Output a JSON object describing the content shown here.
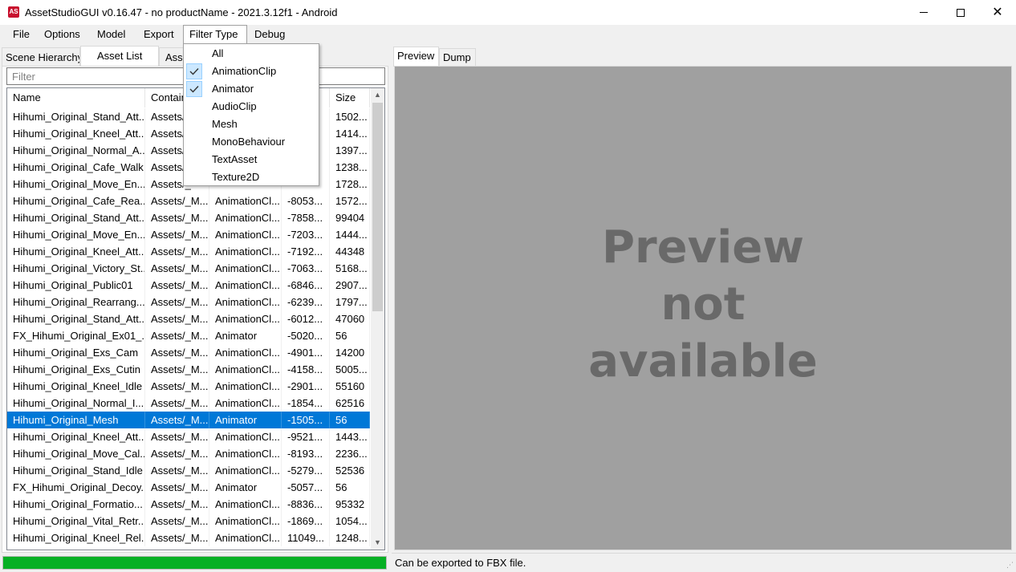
{
  "window": {
    "title": "AssetStudioGUI v0.16.47 - no productName - 2021.3.12f1 - Android",
    "icon_label": "AS",
    "icon_color": "#c8102e"
  },
  "menu": {
    "file": "File",
    "options": "Options",
    "model": "Model",
    "export": "Export",
    "filter_type": "Filter Type",
    "debug": "Debug"
  },
  "filter_dropdown": {
    "items": [
      {
        "label": "All",
        "checked": false
      },
      {
        "label": "AnimationClip",
        "checked": true
      },
      {
        "label": "Animator",
        "checked": true
      },
      {
        "label": "AudioClip",
        "checked": false
      },
      {
        "label": "Mesh",
        "checked": false
      },
      {
        "label": "MonoBehaviour",
        "checked": false
      },
      {
        "label": "TextAsset",
        "checked": false
      },
      {
        "label": "Texture2D",
        "checked": false
      }
    ]
  },
  "left_tabs": {
    "scene_hierarchy": "Scene Hierarchy",
    "asset_list": "Asset List",
    "asset_classes": "Asse"
  },
  "filter_box": {
    "placeholder": "Filter",
    "value": ""
  },
  "asset_list": {
    "columns": [
      "Name",
      "Contain",
      "",
      "",
      "Size"
    ],
    "rows": [
      [
        "Hihumi_Original_Stand_Att...",
        "Assets/_",
        "",
        "",
        "1502..."
      ],
      [
        "Hihumi_Original_Kneel_Att...",
        "Assets/_",
        "",
        "",
        "1414..."
      ],
      [
        "Hihumi_Original_Normal_A...",
        "Assets/_",
        "",
        "",
        "1397..."
      ],
      [
        "Hihumi_Original_Cafe_Walk",
        "Assets/_",
        "",
        "",
        "1238..."
      ],
      [
        "Hihumi_Original_Move_En...",
        "Assets/_",
        "",
        "",
        "1728..."
      ],
      [
        "Hihumi_Original_Cafe_Rea...",
        "Assets/_M...",
        "AnimationCl...",
        "-8053...",
        "1572..."
      ],
      [
        "Hihumi_Original_Stand_Att...",
        "Assets/_M...",
        "AnimationCl...",
        "-7858...",
        "99404"
      ],
      [
        "Hihumi_Original_Move_En...",
        "Assets/_M...",
        "AnimationCl...",
        "-7203...",
        "1444..."
      ],
      [
        "Hihumi_Original_Kneel_Att...",
        "Assets/_M...",
        "AnimationCl...",
        "-7192...",
        "44348"
      ],
      [
        "Hihumi_Original_Victory_St...",
        "Assets/_M...",
        "AnimationCl...",
        "-7063...",
        "5168..."
      ],
      [
        "Hihumi_Original_Public01",
        "Assets/_M...",
        "AnimationCl...",
        "-6846...",
        "2907..."
      ],
      [
        "Hihumi_Original_Rearrang...",
        "Assets/_M...",
        "AnimationCl...",
        "-6239...",
        "1797..."
      ],
      [
        "Hihumi_Original_Stand_Att...",
        "Assets/_M...",
        "AnimationCl...",
        "-6012...",
        "47060"
      ],
      [
        "FX_Hihumi_Original_Ex01_...",
        "Assets/_M...",
        "Animator",
        "-5020...",
        "56"
      ],
      [
        "Hihumi_Original_Exs_Cam",
        "Assets/_M...",
        "AnimationCl...",
        "-4901...",
        "14200"
      ],
      [
        "Hihumi_Original_Exs_Cutin",
        "Assets/_M...",
        "AnimationCl...",
        "-4158...",
        "5005..."
      ],
      [
        "Hihumi_Original_Kneel_Idle",
        "Assets/_M...",
        "AnimationCl...",
        "-2901...",
        "55160"
      ],
      [
        "Hihumi_Original_Normal_I...",
        "Assets/_M...",
        "AnimationCl...",
        "-1854...",
        "62516"
      ],
      [
        "Hihumi_Original_Mesh",
        "Assets/_M...",
        "Animator",
        "-1505...",
        "56"
      ],
      [
        "Hihumi_Original_Kneel_Att...",
        "Assets/_M...",
        "AnimationCl...",
        "-9521...",
        "1443..."
      ],
      [
        "Hihumi_Original_Move_Cal...",
        "Assets/_M...",
        "AnimationCl...",
        "-8193...",
        "2236..."
      ],
      [
        "Hihumi_Original_Stand_Idle",
        "Assets/_M...",
        "AnimationCl...",
        "-5279...",
        "52536"
      ],
      [
        "FX_Hihumi_Original_Decoy...",
        "Assets/_M...",
        "Animator",
        "-5057...",
        "56"
      ],
      [
        "Hihumi_Original_Formatio...",
        "Assets/_M...",
        "AnimationCl...",
        "-8836...",
        "95332"
      ],
      [
        "Hihumi_Original_Vital_Retr...",
        "Assets/_M...",
        "AnimationCl...",
        "-1869...",
        "1054..."
      ],
      [
        "Hihumi_Original_Kneel_Rel...",
        "Assets/_M...",
        "AnimationCl...",
        "11049...",
        "1248..."
      ]
    ],
    "selected_row_index": 18,
    "selection_color": "#0078d7"
  },
  "progress": {
    "value_percent": 100,
    "color": "#06b025"
  },
  "right_tabs": {
    "preview": "Preview",
    "dump": "Dump"
  },
  "preview": {
    "line1": "Preview",
    "line2": "not",
    "line3": "available",
    "background": "#a0a0a0"
  },
  "status": {
    "text": "Can be exported to FBX file."
  }
}
